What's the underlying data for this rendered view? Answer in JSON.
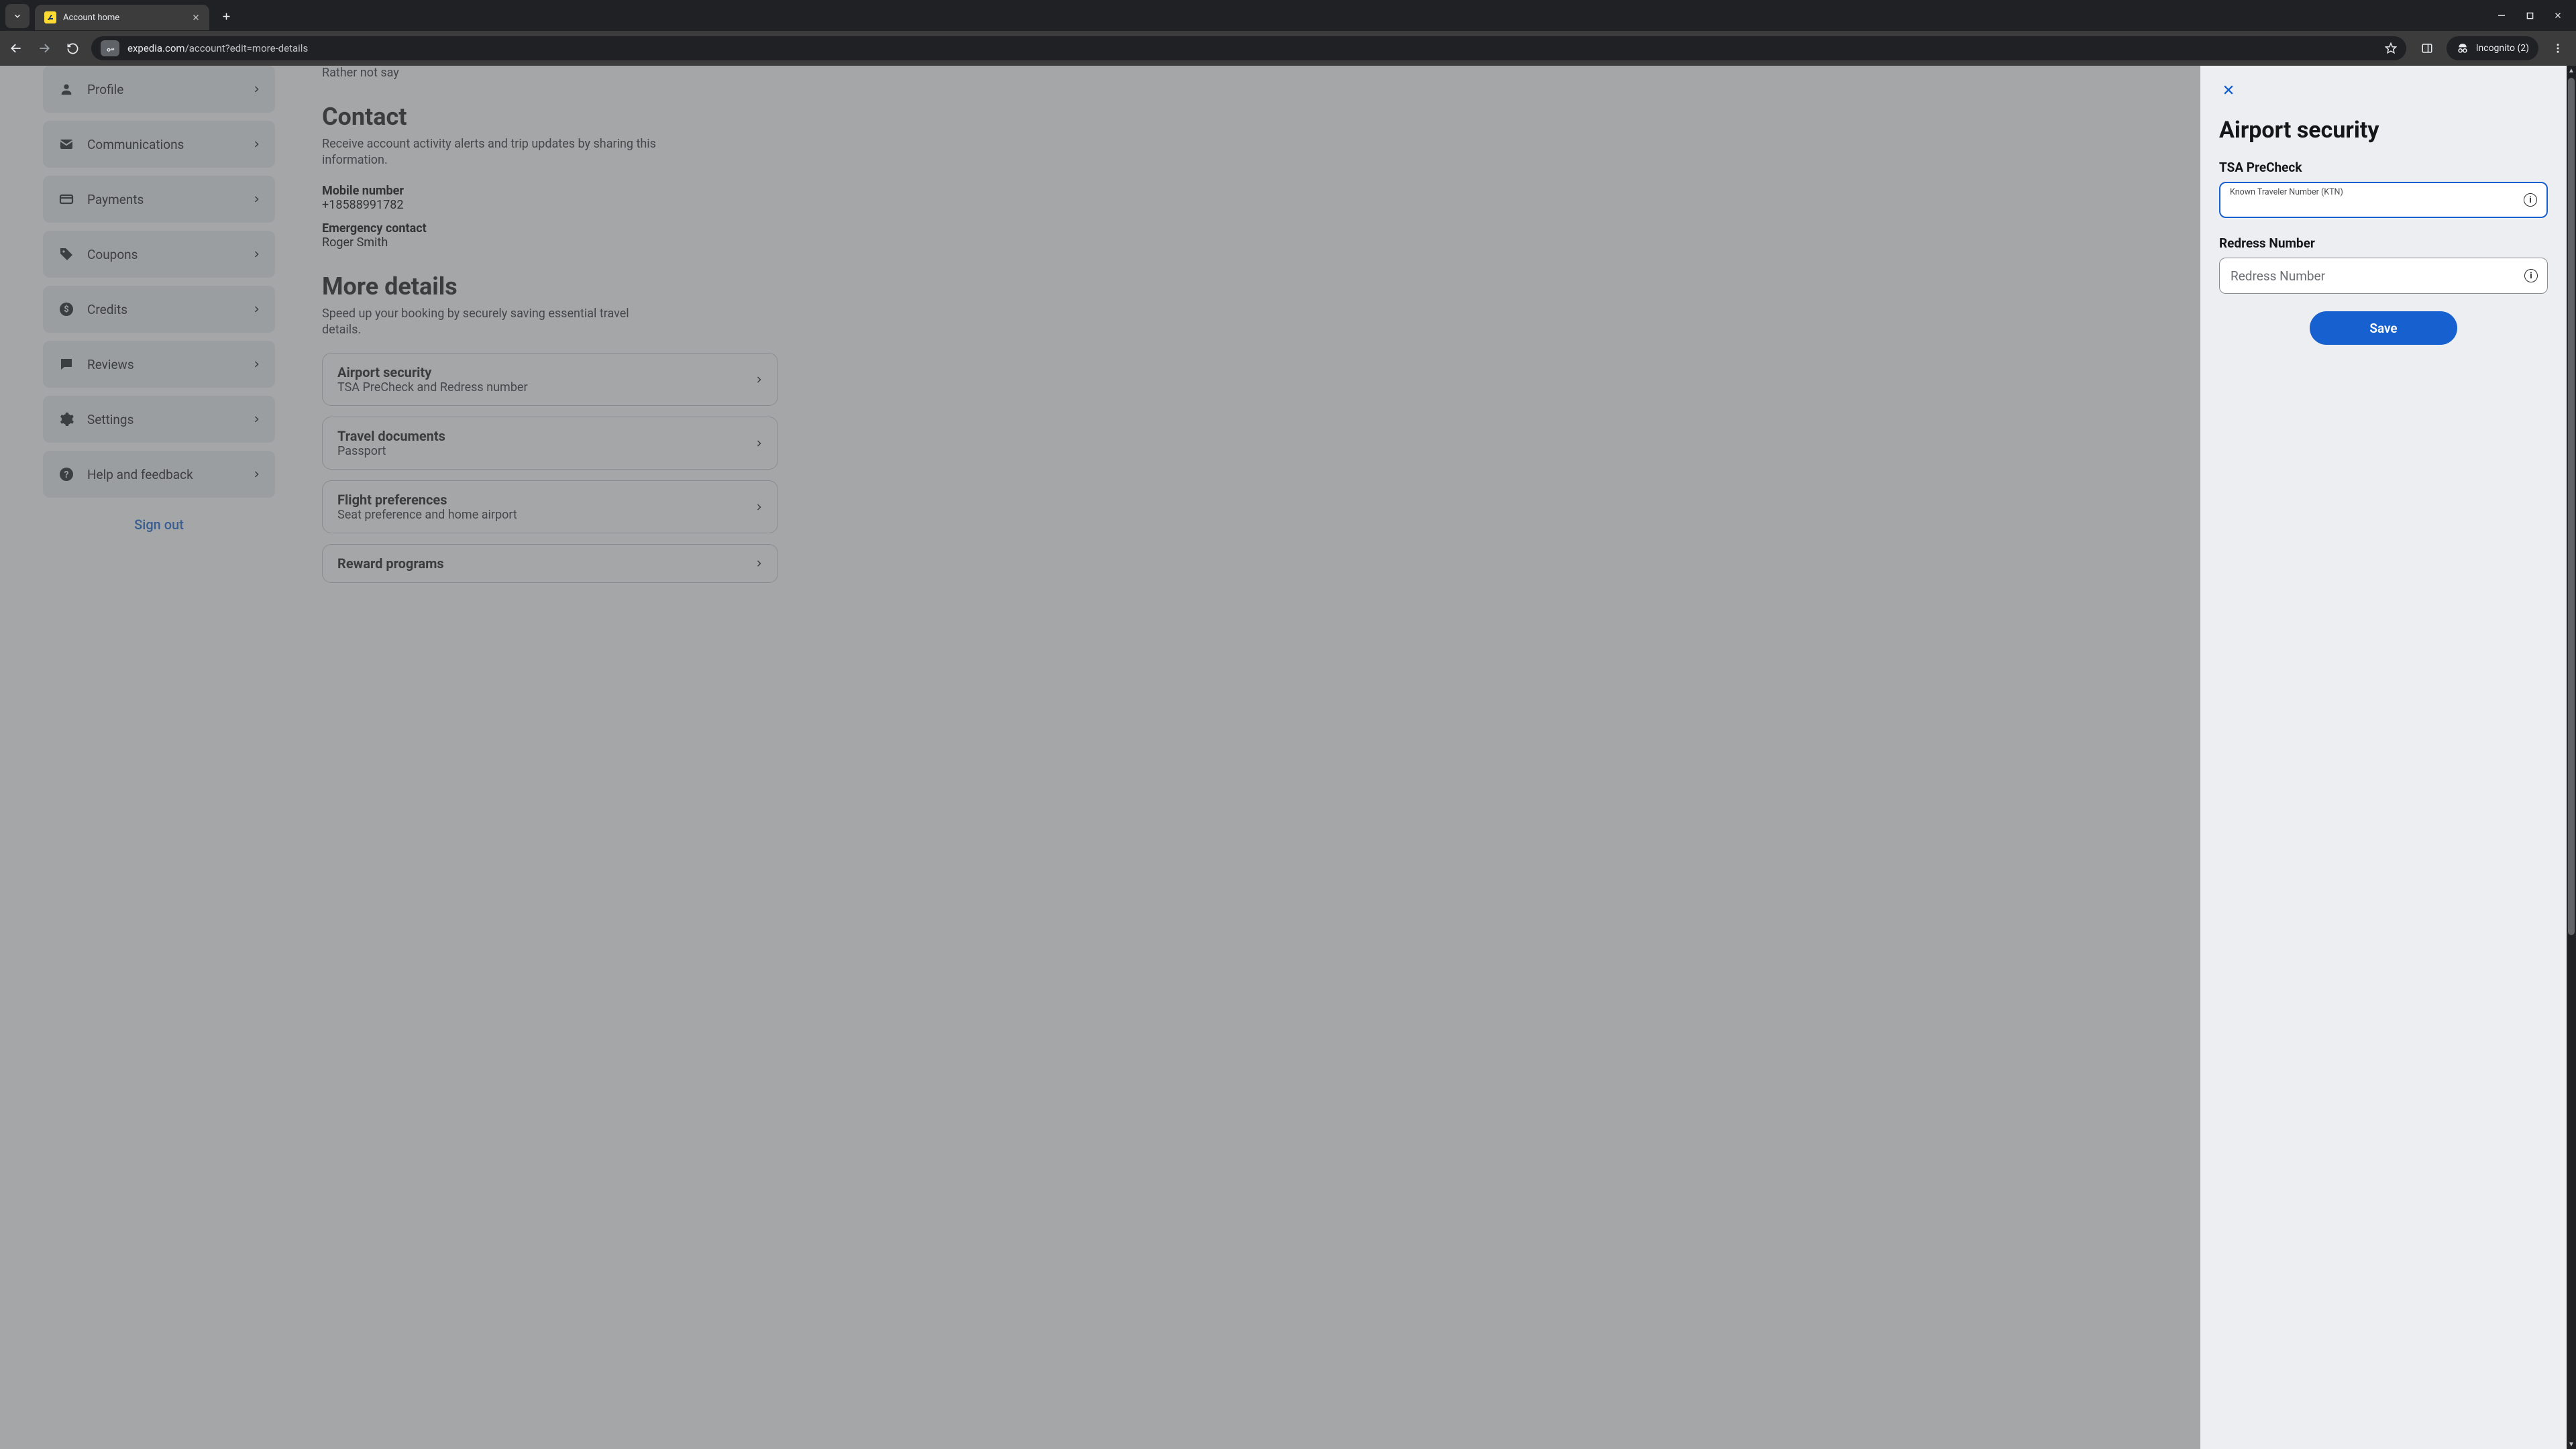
{
  "browser": {
    "tab_title": "Account home",
    "url_host": "expedia.com",
    "url_path": "/account?edit=more-details",
    "incognito_label": "Incognito (2)"
  },
  "sidebar": {
    "items": [
      {
        "label": "Profile",
        "icon": "person-icon"
      },
      {
        "label": "Communications",
        "icon": "mail-icon"
      },
      {
        "label": "Payments",
        "icon": "card-icon"
      },
      {
        "label": "Coupons",
        "icon": "tag-icon"
      },
      {
        "label": "Credits",
        "icon": "dollar-icon"
      },
      {
        "label": "Reviews",
        "icon": "chat-icon"
      },
      {
        "label": "Settings",
        "icon": "gear-icon"
      },
      {
        "label": "Help and feedback",
        "icon": "help-icon"
      }
    ],
    "signout": "Sign out"
  },
  "page": {
    "accessibility_value": "Rather not say",
    "contact": {
      "heading": "Contact",
      "sub": "Receive account activity alerts and trip updates by sharing this information.",
      "mobile_label": "Mobile number",
      "mobile_value": "+18588991782",
      "emergency_label": "Emergency contact",
      "emergency_value": "Roger Smith"
    },
    "more": {
      "heading": "More details",
      "sub": "Speed up your booking by securely saving essential travel details.",
      "cards": [
        {
          "title": "Airport security",
          "sub": "TSA PreCheck and Redress number"
        },
        {
          "title": "Travel documents",
          "sub": "Passport"
        },
        {
          "title": "Flight preferences",
          "sub": "Seat preference and home airport"
        },
        {
          "title": "Reward programs",
          "sub": ""
        }
      ]
    }
  },
  "drawer": {
    "title": "Airport security",
    "tsa_label": "TSA PreCheck",
    "ktn_floating": "Known Traveler Number (KTN)",
    "ktn_value": "",
    "redress_label": "Redress Number",
    "redress_placeholder": "Redress Number",
    "redress_value": "",
    "save": "Save"
  }
}
